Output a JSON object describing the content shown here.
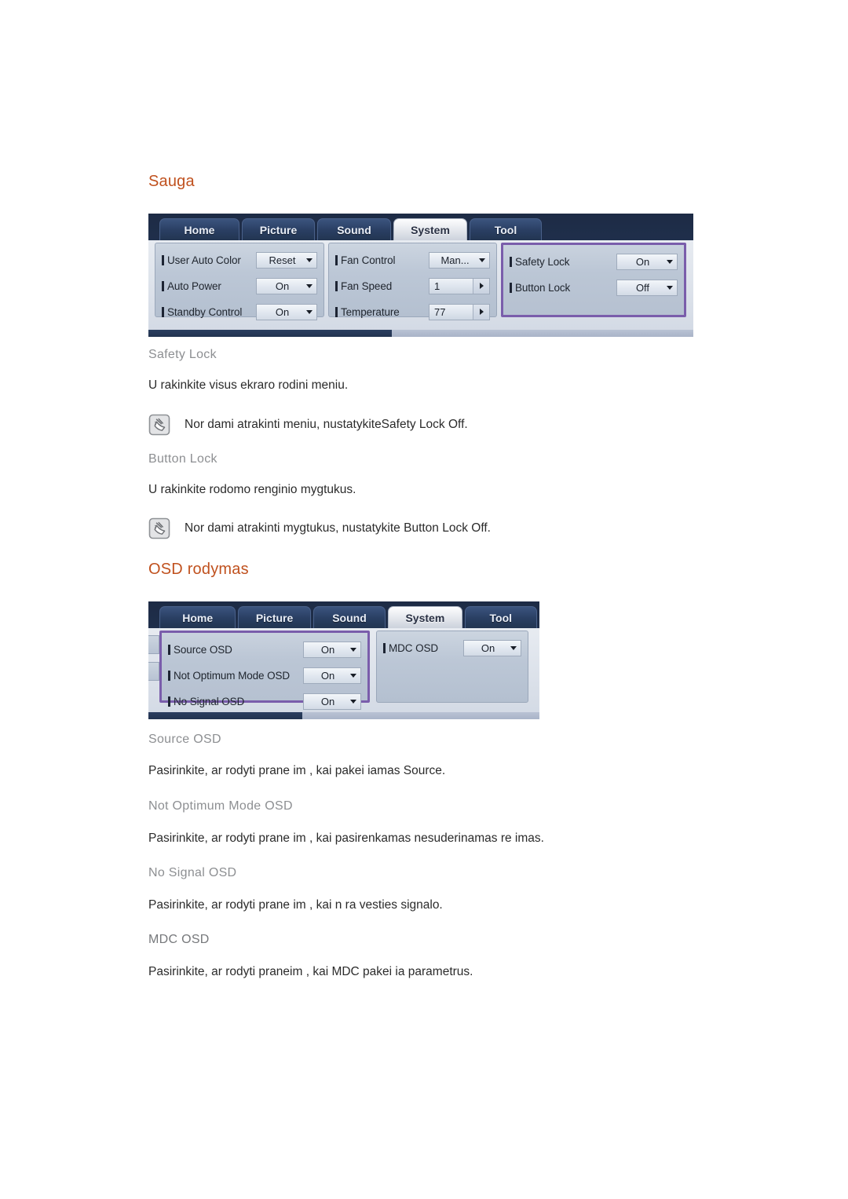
{
  "sections": [
    {
      "heading": "Sauga",
      "panel": {
        "tabs": [
          {
            "label": "Home",
            "active": false
          },
          {
            "label": "Picture",
            "active": false
          },
          {
            "label": "Sound",
            "active": false
          },
          {
            "label": "System",
            "active": true
          },
          {
            "label": "Tool",
            "active": false
          }
        ],
        "columns": [
          {
            "highlight": false,
            "rows": [
              {
                "label": "User Auto Color",
                "value": "Reset",
                "control": "dropdown"
              },
              {
                "label": "Auto Power",
                "value": "On",
                "control": "dropdown"
              },
              {
                "label": "Standby Control",
                "value": "On",
                "control": "dropdown"
              }
            ]
          },
          {
            "highlight": false,
            "rows": [
              {
                "label": "Fan Control",
                "value": "Man...",
                "control": "dropdown"
              },
              {
                "label": "Fan Speed",
                "value": "1",
                "control": "stepper"
              },
              {
                "label": "Temperature",
                "value": "77",
                "control": "stepper"
              }
            ]
          },
          {
            "highlight": true,
            "rows": [
              {
                "label": "Safety Lock",
                "value": "On",
                "control": "dropdown"
              },
              {
                "label": "Button Lock",
                "value": "Off",
                "control": "dropdown"
              }
            ]
          }
        ]
      },
      "blocks": [
        {
          "type": "subheading",
          "text": "Safety Lock",
          "dark": false
        },
        {
          "type": "paragraph",
          "text": "U rakinkite visus ekraro rodini  meniu."
        },
        {
          "type": "note",
          "icon": "note-hand-icon",
          "text": "Nor dami atrakinti meniu, nustatykiteSafety Lock   Off."
        },
        {
          "type": "subheading",
          "text": "Button Lock",
          "dark": false
        },
        {
          "type": "paragraph",
          "text": "U rakinkite rodomo  renginio mygtukus."
        },
        {
          "type": "note",
          "icon": "note-hand-icon",
          "text": "Nor dami atrakinti mygtukus, nustatykite Button Lock  Off."
        }
      ]
    },
    {
      "heading": "OSD rodymas",
      "panel": {
        "tabs": [
          {
            "label": "Home",
            "active": false
          },
          {
            "label": "Picture",
            "active": false
          },
          {
            "label": "Sound",
            "active": false
          },
          {
            "label": "System",
            "active": true
          },
          {
            "label": "Tool",
            "active": false
          }
        ],
        "columns": [
          {
            "highlight": true,
            "rows": [
              {
                "label": "Source OSD",
                "value": "On",
                "control": "dropdown"
              },
              {
                "label": "Not Optimum Mode OSD",
                "value": "On",
                "control": "dropdown"
              },
              {
                "label": "No Signal OSD",
                "value": "On",
                "control": "dropdown"
              }
            ]
          },
          {
            "highlight": false,
            "rows": [
              {
                "label": "MDC OSD",
                "value": "On",
                "control": "dropdown"
              }
            ]
          }
        ]
      },
      "blocks": [
        {
          "type": "subheading",
          "text": "Source OSD",
          "dark": false
        },
        {
          "type": "paragraph",
          "text": "Pasirinkite, ar rodyti prane im , kai pakei iamas Source."
        },
        {
          "type": "subheading",
          "text": "Not Optimum Mode OSD",
          "dark": false
        },
        {
          "type": "paragraph",
          "text": "Pasirinkite, ar rodyti prane im , kai pasirenkamas nesuderinamas re imas."
        },
        {
          "type": "subheading",
          "text": "No Signal OSD",
          "dark": false
        },
        {
          "type": "paragraph",
          "text": "Pasirinkite, ar rodyti prane im , kai n ra  vesties signalo."
        },
        {
          "type": "subheading",
          "text": "MDC OSD",
          "dark": true
        },
        {
          "type": "paragraph",
          "text": "Pasirinkite, ar rodyti praneim , kai MDC pakei ia parametrus."
        }
      ]
    }
  ],
  "colors": {
    "heading": "#c0511e",
    "subheading": "#8d8f92",
    "subheading_dark": "#76787b",
    "body": "#2b2b2b",
    "panel_chrome": "#22324f",
    "highlight_border": "#7a5dab"
  }
}
